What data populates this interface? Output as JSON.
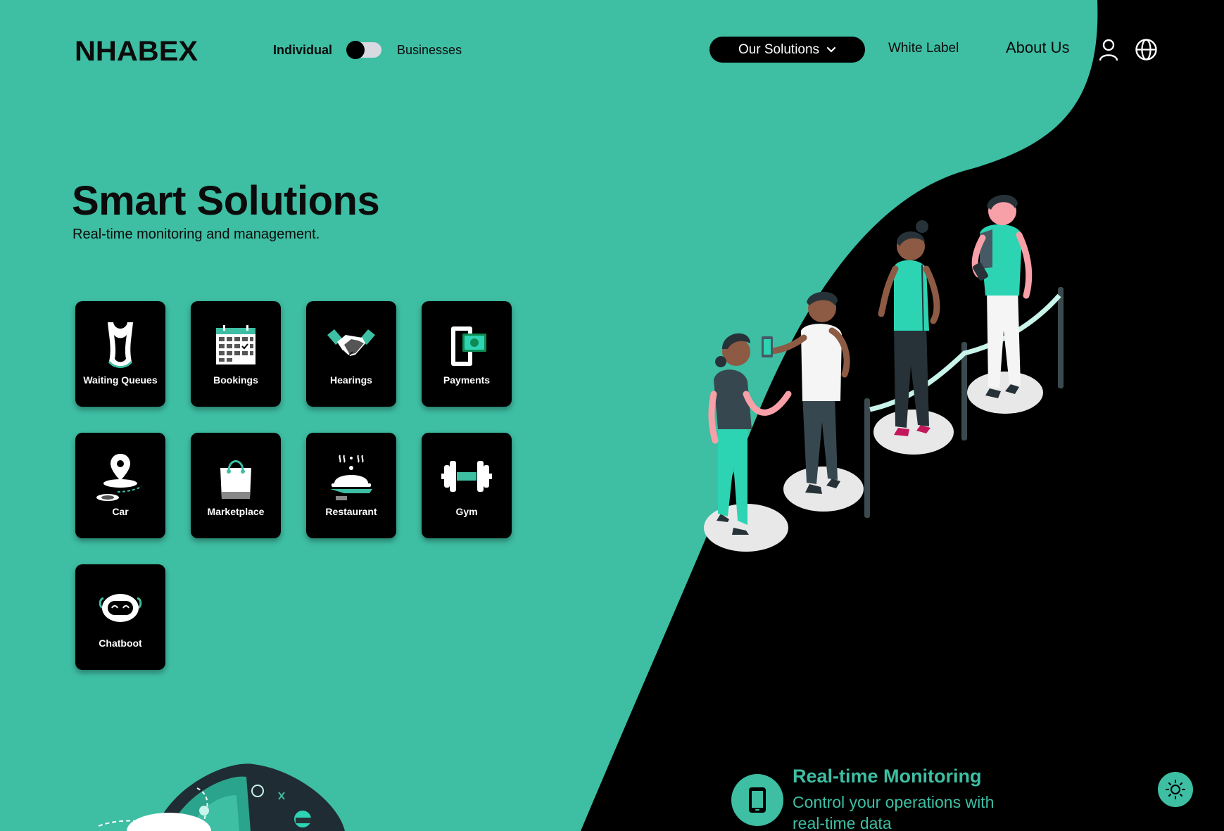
{
  "brand": {
    "logo_text": "NHABEX"
  },
  "header": {
    "mode": {
      "left_label": "Individual",
      "right_label": "Businesses"
    },
    "nav": {
      "solutions_label": "Our Solutions",
      "white_label": "White Label",
      "about_label": "About Us"
    },
    "icons": [
      "user-icon",
      "globe-icon"
    ]
  },
  "hero": {
    "title": "Smart Solutions",
    "subtitle": "Real-time monitoring and management."
  },
  "tiles": [
    {
      "label": "Waiting Queues",
      "icon": "queue-icon"
    },
    {
      "label": "Bookings",
      "icon": "calendar-icon"
    },
    {
      "label": "Hearings",
      "icon": "handshake-icon"
    },
    {
      "label": "Payments",
      "icon": "wallet-icon"
    },
    {
      "label": "Car",
      "icon": "location-pin-icon"
    },
    {
      "label": "Marketplace",
      "icon": "shopping-bag-icon"
    },
    {
      "label": "Restaurant",
      "icon": "cloche-icon"
    },
    {
      "label": "Gym",
      "icon": "dumbbell-icon"
    },
    {
      "label": "Chatboot",
      "icon": "robot-icon"
    }
  ],
  "feature": {
    "title": "Real-time Monitoring",
    "text": "Control your operations with real-time data",
    "icon": "smartphone-icon"
  },
  "colors": {
    "accent": "#3ebea3",
    "dark": "#000000",
    "mint": "#2dd4b3"
  }
}
